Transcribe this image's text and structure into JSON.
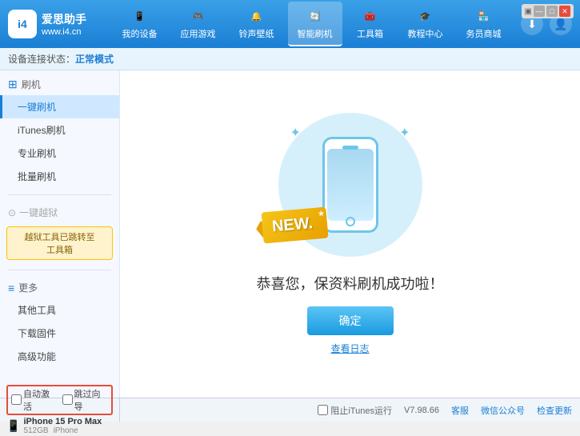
{
  "app": {
    "logo_letter": "i4",
    "logo_site": "www.i4.cn",
    "logo_name": "爱思助手"
  },
  "nav": {
    "tabs": [
      {
        "id": "my-device",
        "label": "我的设备",
        "icon": "📱"
      },
      {
        "id": "apps-games",
        "label": "应用游戏",
        "icon": "🎮"
      },
      {
        "id": "ringtone",
        "label": "铃声壁纸",
        "icon": "🔔"
      },
      {
        "id": "smart-flash",
        "label": "智能刷机",
        "icon": "🔄"
      },
      {
        "id": "toolbox",
        "label": "工具箱",
        "icon": "🧰"
      },
      {
        "id": "tutorial",
        "label": "教程中心",
        "icon": "🎓"
      },
      {
        "id": "merchant",
        "label": "务员商城",
        "icon": "🏪"
      }
    ],
    "active_tab": "smart-flash"
  },
  "window_controls": {
    "minimize": "—",
    "restore": "□",
    "close": "✕"
  },
  "sub_bar": {
    "prefix": "设备连接状态：",
    "status": "正常模式"
  },
  "sidebar": {
    "sections": [
      {
        "id": "flash",
        "icon": "⊞",
        "label": "刷机",
        "items": [
          {
            "id": "one-key-flash",
            "label": "一键刷机",
            "active": true
          },
          {
            "id": "itunes-flash",
            "label": "iTunes刷机",
            "active": false
          },
          {
            "id": "pro-flash",
            "label": "专业刷机",
            "active": false
          },
          {
            "id": "batch-flash",
            "label": "批量刷机",
            "active": false
          }
        ]
      },
      {
        "id": "one-key-activate",
        "icon": "⊞",
        "label": "一键越狱",
        "disabled": true,
        "notice": "越狱工具已跳转至\n工具箱"
      },
      {
        "id": "more",
        "icon": "≡",
        "label": "更多",
        "items": [
          {
            "id": "other-tools",
            "label": "其他工具",
            "active": false
          },
          {
            "id": "download-firmware",
            "label": "下载固件",
            "active": false
          },
          {
            "id": "advanced",
            "label": "高级功能",
            "active": false
          }
        ]
      }
    ]
  },
  "content": {
    "success_text": "恭喜您，保资料刷机成功啦！",
    "confirm_label": "确定",
    "log_label": "查看日志"
  },
  "bottom": {
    "auto_activate_label": "自动激活",
    "guide_label": "跳过向导",
    "device_name": "iPhone 15 Pro Max",
    "device_storage": "512GB",
    "device_type": "iPhone",
    "version": "V7.98.66",
    "service_label": "客服",
    "wechat_label": "微信公众号",
    "check_update_label": "检查更新",
    "stop_itunes_label": "阻止iTunes运行"
  }
}
